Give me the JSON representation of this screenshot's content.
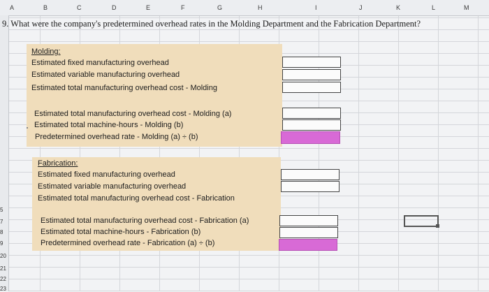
{
  "columns": [
    "A",
    "B",
    "C",
    "D",
    "E",
    "F",
    "G",
    "H",
    "I",
    "J",
    "K",
    "L",
    "M"
  ],
  "rows": [
    "5",
    "",
    "7",
    "8",
    "9",
    "20",
    "21",
    "22",
    "23"
  ],
  "question": "9. What were the company's predetermined overhead rates in the Molding Department and the Fabrication Department?",
  "molding": {
    "heading": "Molding:",
    "fixed": "Estimated fixed manufacturing overhead",
    "variable": "Estimated variable manufacturing overhead",
    "total": "Estimated total manufacturing overhead cost - Molding",
    "total_a": "Estimated total manufacturing overhead cost - Molding (a)",
    "hours_b": "Estimated total machine-hours - Molding (b)",
    "rate": "Predetermined overhead rate - Molding (a) ÷ (b)"
  },
  "fabrication": {
    "heading": "Fabrication:",
    "fixed": "Estimated fixed manufacturing overhead",
    "variable": "Estimated variable manufacturing overhead",
    "total": "Estimated total manufacturing overhead cost - Fabrication",
    "total_a": "Estimated total manufacturing overhead cost - Fabrication (a)",
    "hours_b": "Estimated total machine-hours - Fabrication (b)",
    "rate": "Predetermined overhead rate - Fabrication (a) ÷ (b)"
  },
  "colors": {
    "label_fill": "#f0ddbb",
    "rate_fill": "#d86ad6"
  }
}
